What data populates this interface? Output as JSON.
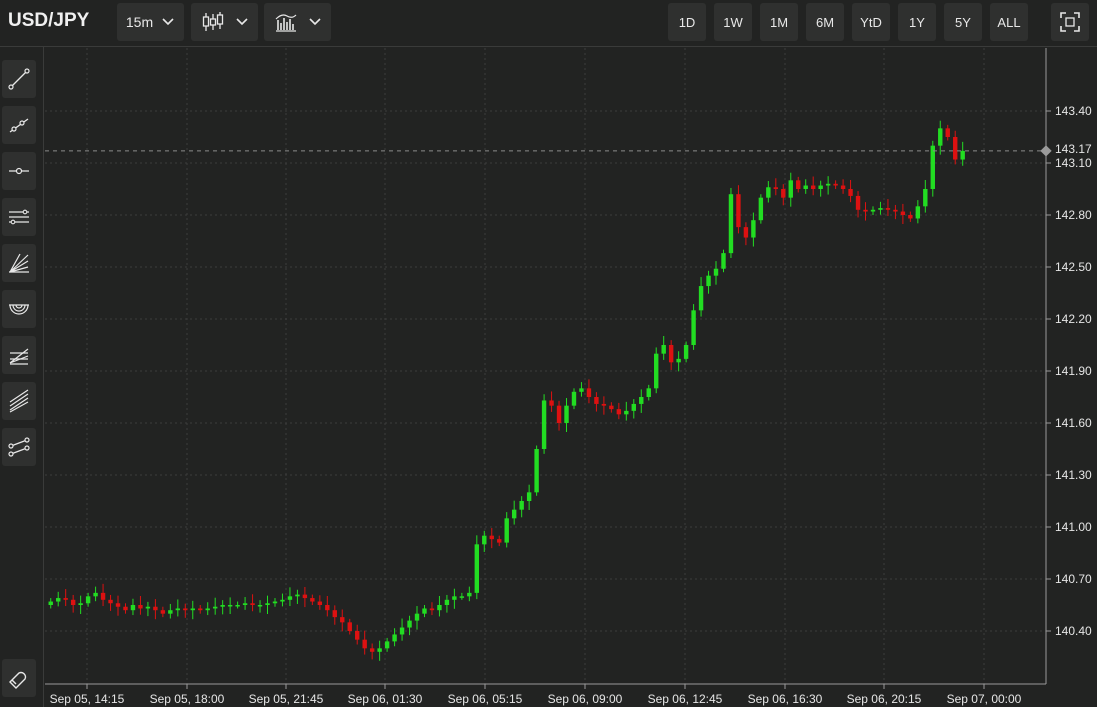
{
  "header": {
    "symbol": "USD/JPY",
    "interval": "15m",
    "chart_type_icon": "candlestick-icon",
    "indicators_icon": "indicators-icon",
    "ranges": [
      "1D",
      "1W",
      "1M",
      "6M",
      "YtD",
      "1Y",
      "5Y",
      "ALL"
    ],
    "fullscreen_icon": "fullscreen-icon"
  },
  "sidebar": {
    "tools": [
      "trend-line-icon",
      "ray-icon",
      "horizontal-line-icon",
      "parallel-channel-icon",
      "fan-icon",
      "fibonacci-arc-icon",
      "fibonacci-retracement-icon",
      "pitchfork-icon",
      "polyline-icon"
    ],
    "magnet_icon": "magnet-icon"
  },
  "colors": {
    "background": "#222322",
    "grid": "#3c3d3c",
    "up": "#22dd22",
    "down": "#dd1111",
    "text": "#e6e6e6",
    "price_line": "#8a8a8a"
  },
  "chart_data": {
    "type": "candlestick",
    "series": "USD/JPY",
    "interval": "15m",
    "ylim": [
      140.2,
      143.7
    ],
    "y_ticks": [
      "140.40",
      "140.70",
      "141.00",
      "141.30",
      "141.60",
      "141.90",
      "142.20",
      "142.50",
      "142.80",
      "143.10",
      "143.40"
    ],
    "x_labels": [
      "Sep 05, 14:15",
      "Sep 05, 18:00",
      "Sep 05, 21:45",
      "Sep 06, 01:30",
      "Sep 06, 05:15",
      "Sep 06, 09:00",
      "Sep 06, 12:45",
      "Sep 06, 16:30",
      "Sep 06, 20:15",
      "Sep 07, 00:00"
    ],
    "current_price": "143.17",
    "grid": true,
    "closes": [
      140.57,
      140.59,
      140.58,
      140.55,
      140.56,
      140.6,
      140.62,
      140.58,
      140.56,
      140.54,
      140.52,
      140.55,
      140.53,
      140.54,
      140.52,
      140.5,
      140.52,
      140.53,
      140.52,
      140.53,
      140.52,
      140.53,
      140.54,
      140.55,
      140.55,
      140.55,
      140.56,
      140.55,
      140.55,
      140.56,
      140.57,
      140.58,
      140.6,
      140.61,
      140.59,
      140.57,
      140.55,
      140.52,
      140.48,
      140.45,
      140.4,
      140.35,
      140.3,
      140.28,
      140.3,
      140.34,
      140.38,
      140.42,
      140.46,
      140.5,
      140.53,
      140.52,
      140.55,
      140.58,
      140.6,
      140.6,
      140.62,
      140.9,
      140.95,
      140.93,
      140.91,
      141.05,
      141.1,
      141.15,
      141.2,
      141.45,
      141.73,
      141.7,
      141.6,
      141.7,
      141.78,
      141.8,
      141.75,
      141.71,
      141.7,
      141.68,
      141.65,
      141.67,
      141.71,
      141.75,
      141.8,
      142.0,
      142.05,
      141.95,
      141.97,
      142.05,
      142.25,
      142.39,
      142.45,
      142.49,
      142.58,
      142.92,
      142.73,
      142.67,
      142.77,
      142.9,
      142.96,
      142.95,
      142.9,
      143.0,
      142.95,
      142.97,
      142.95,
      142.97,
      142.98,
      142.97,
      142.95,
      142.91,
      142.83,
      142.82,
      142.83,
      142.84,
      142.83,
      142.82,
      142.8,
      142.78,
      142.85,
      142.95,
      143.2,
      143.3,
      143.25,
      143.12,
      143.17
    ],
    "opens_note": "each candle opens at the previous close"
  }
}
